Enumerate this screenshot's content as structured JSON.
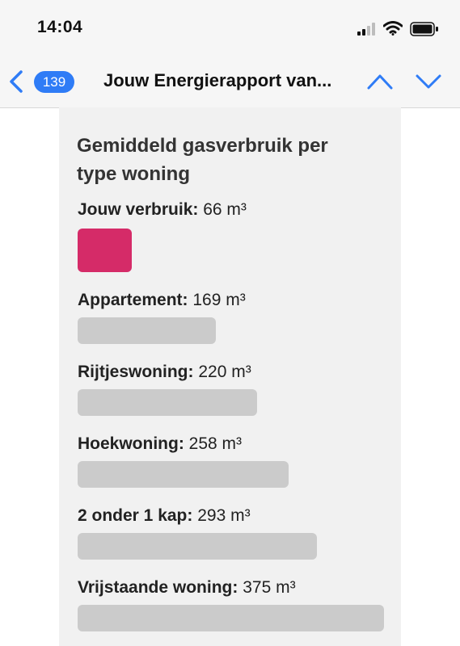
{
  "status_bar": {
    "time": "14:04"
  },
  "nav": {
    "unread_count": "139",
    "title": "Jouw Energierapport van..."
  },
  "colors": {
    "accent": "#d52b68",
    "bar": "#cbcbcb",
    "badge": "#2f7cf6"
  },
  "report": {
    "title": "Gemiddeld gasverbruik per type woning",
    "items": [
      {
        "label": "Jouw verbruik:",
        "value": "66 m³",
        "amount": 66
      },
      {
        "label": "Appartement:",
        "value": "169 m³",
        "amount": 169
      },
      {
        "label": "Rijtjeswoning:",
        "value": "220 m³",
        "amount": 220
      },
      {
        "label": "Hoekwoning:",
        "value": "258 m³",
        "amount": 258
      },
      {
        "label": "2 onder 1 kap:",
        "value": "293 m³",
        "amount": 293
      },
      {
        "label": "Vrijstaande woning:",
        "value": "375 m³",
        "amount": 375
      }
    ]
  }
}
